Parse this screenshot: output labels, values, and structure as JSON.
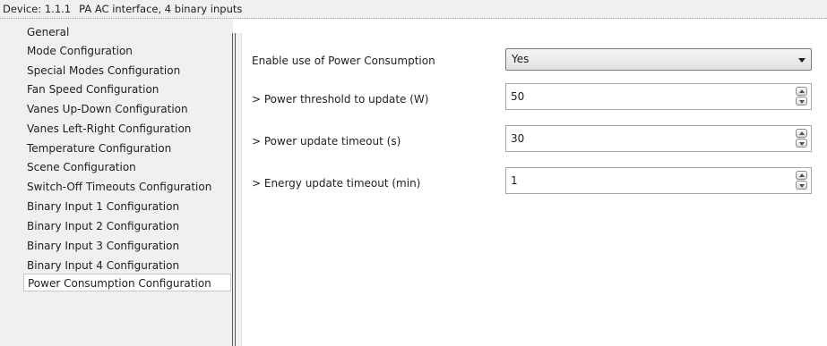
{
  "device_bar": {
    "device": "Device: 1.1.1",
    "description": "PA AC interface, 4 binary inputs"
  },
  "sidebar": {
    "items": [
      {
        "label": "General"
      },
      {
        "label": "Mode Configuration"
      },
      {
        "label": "Special Modes Configuration"
      },
      {
        "label": "Fan Speed Configuration"
      },
      {
        "label": "Vanes Up-Down Configuration"
      },
      {
        "label": "Vanes Left-Right Configuration"
      },
      {
        "label": "Temperature Configuration"
      },
      {
        "label": "Scene Configuration"
      },
      {
        "label": "Switch-Off Timeouts Configuration"
      },
      {
        "label": "Binary Input 1 Configuration"
      },
      {
        "label": "Binary Input 2 Configuration"
      },
      {
        "label": "Binary Input 3 Configuration"
      },
      {
        "label": "Binary Input 4 Configuration"
      },
      {
        "label": "Power Consumption Configuration"
      }
    ],
    "selected": "Power Consumption Configuration"
  },
  "params": {
    "enable": {
      "label": "Enable use of Power Consumption",
      "value": "Yes"
    },
    "threshold": {
      "label": "> Power threshold to update (W)",
      "value": "50"
    },
    "power_timeout": {
      "label": "> Power update timeout (s)",
      "value": "30"
    },
    "energy_timeout": {
      "label": "> Energy update timeout (min)",
      "value": "1"
    }
  },
  "icons": {
    "dropdown": "chevron-down-icon",
    "spin_up": "spin-up-icon",
    "spin_down": "spin-down-icon"
  }
}
